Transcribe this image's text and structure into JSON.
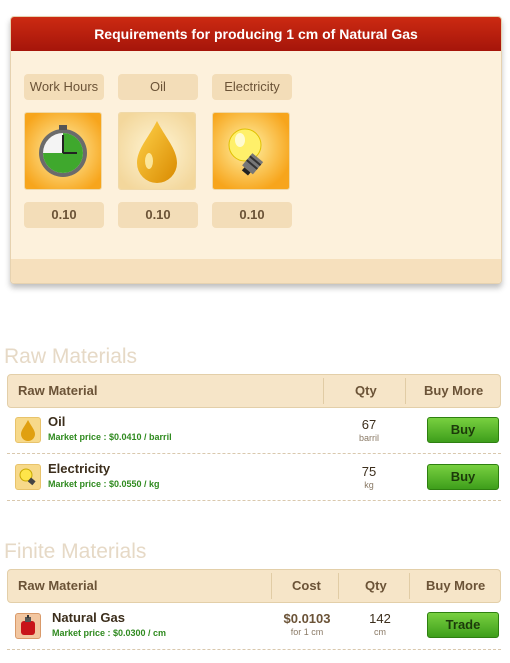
{
  "requirements": {
    "title": "Requirements for producing 1 cm of Natural Gas",
    "items": [
      {
        "label": "Work Hours",
        "value": "0.10",
        "icon": "clock-icon"
      },
      {
        "label": "Oil",
        "value": "0.10",
        "icon": "oil-drop-icon"
      },
      {
        "label": "Electricity",
        "value": "0.10",
        "icon": "light-bulb-icon"
      }
    ]
  },
  "raw_materials": {
    "title": "Raw Materials",
    "headers": {
      "material": "Raw Material",
      "qty": "Qty",
      "action": "Buy More"
    },
    "rows": [
      {
        "name": "Oil",
        "price": "Market price : $0.0410 / barril",
        "qty": "67",
        "unit": "barril",
        "button": "Buy",
        "icon": "oil-drop-icon"
      },
      {
        "name": "Electricity",
        "price": "Market price : $0.0550 / kg",
        "qty": "75",
        "unit": "kg",
        "button": "Buy",
        "icon": "light-bulb-icon"
      }
    ]
  },
  "finite_materials": {
    "title": "Finite Materials",
    "headers": {
      "material": "Raw Material",
      "cost": "Cost",
      "qty": "Qty",
      "action": "Buy More"
    },
    "rows": [
      {
        "name": "Natural Gas",
        "price": "Market price : $0.0300 / cm",
        "cost": "$0.0103",
        "cost_sub": "for 1 cm",
        "qty": "142",
        "unit": "cm",
        "button": "Trade",
        "icon": "gas-cylinder-icon"
      }
    ]
  },
  "colors": {
    "header_red": "#b81c0d",
    "button_green": "#5bb82e",
    "price_green": "#2f8a1f"
  }
}
